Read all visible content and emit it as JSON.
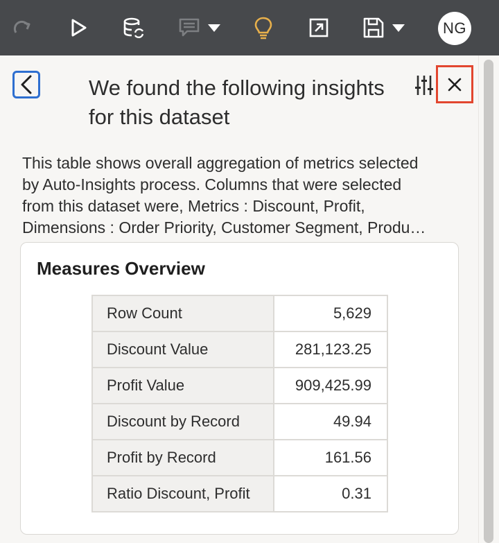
{
  "toolbar": {
    "redo_icon": "redo-icon",
    "run_icon": "play-icon",
    "data_refresh_icon": "database-refresh-icon",
    "narrate_icon": "comment-icon",
    "insights_icon": "lightbulb-icon",
    "export_icon": "export-icon",
    "save_icon": "save-icon",
    "user_initials": "NG",
    "colors": {
      "background": "#47494c",
      "icon": "#ffffff",
      "insights_accent": "#e8b04b"
    }
  },
  "panel": {
    "title": "We found the following insights for this dataset",
    "description_lines": [
      "This table shows overall aggregation of metrics selected",
      "by Auto-Insights process. Columns that were selected",
      "from this dataset were, Metrics : Discount, Profit,",
      "Dimensions : Order Priority, Customer Segment, Produ…"
    ],
    "close_highlight_color": "#e2462f",
    "back_highlight_color": "#2e6fd0"
  },
  "card": {
    "title": "Measures Overview",
    "rows": [
      {
        "label": "Row Count",
        "value": "5,629"
      },
      {
        "label": "Discount Value",
        "value": "281,123.25"
      },
      {
        "label": "Profit Value",
        "value": "909,425.99"
      },
      {
        "label": "Discount by Record",
        "value": "49.94"
      },
      {
        "label": "Profit by Record",
        "value": "161.56"
      },
      {
        "label": "Ratio Discount, Profit",
        "value": "0.31"
      }
    ]
  }
}
